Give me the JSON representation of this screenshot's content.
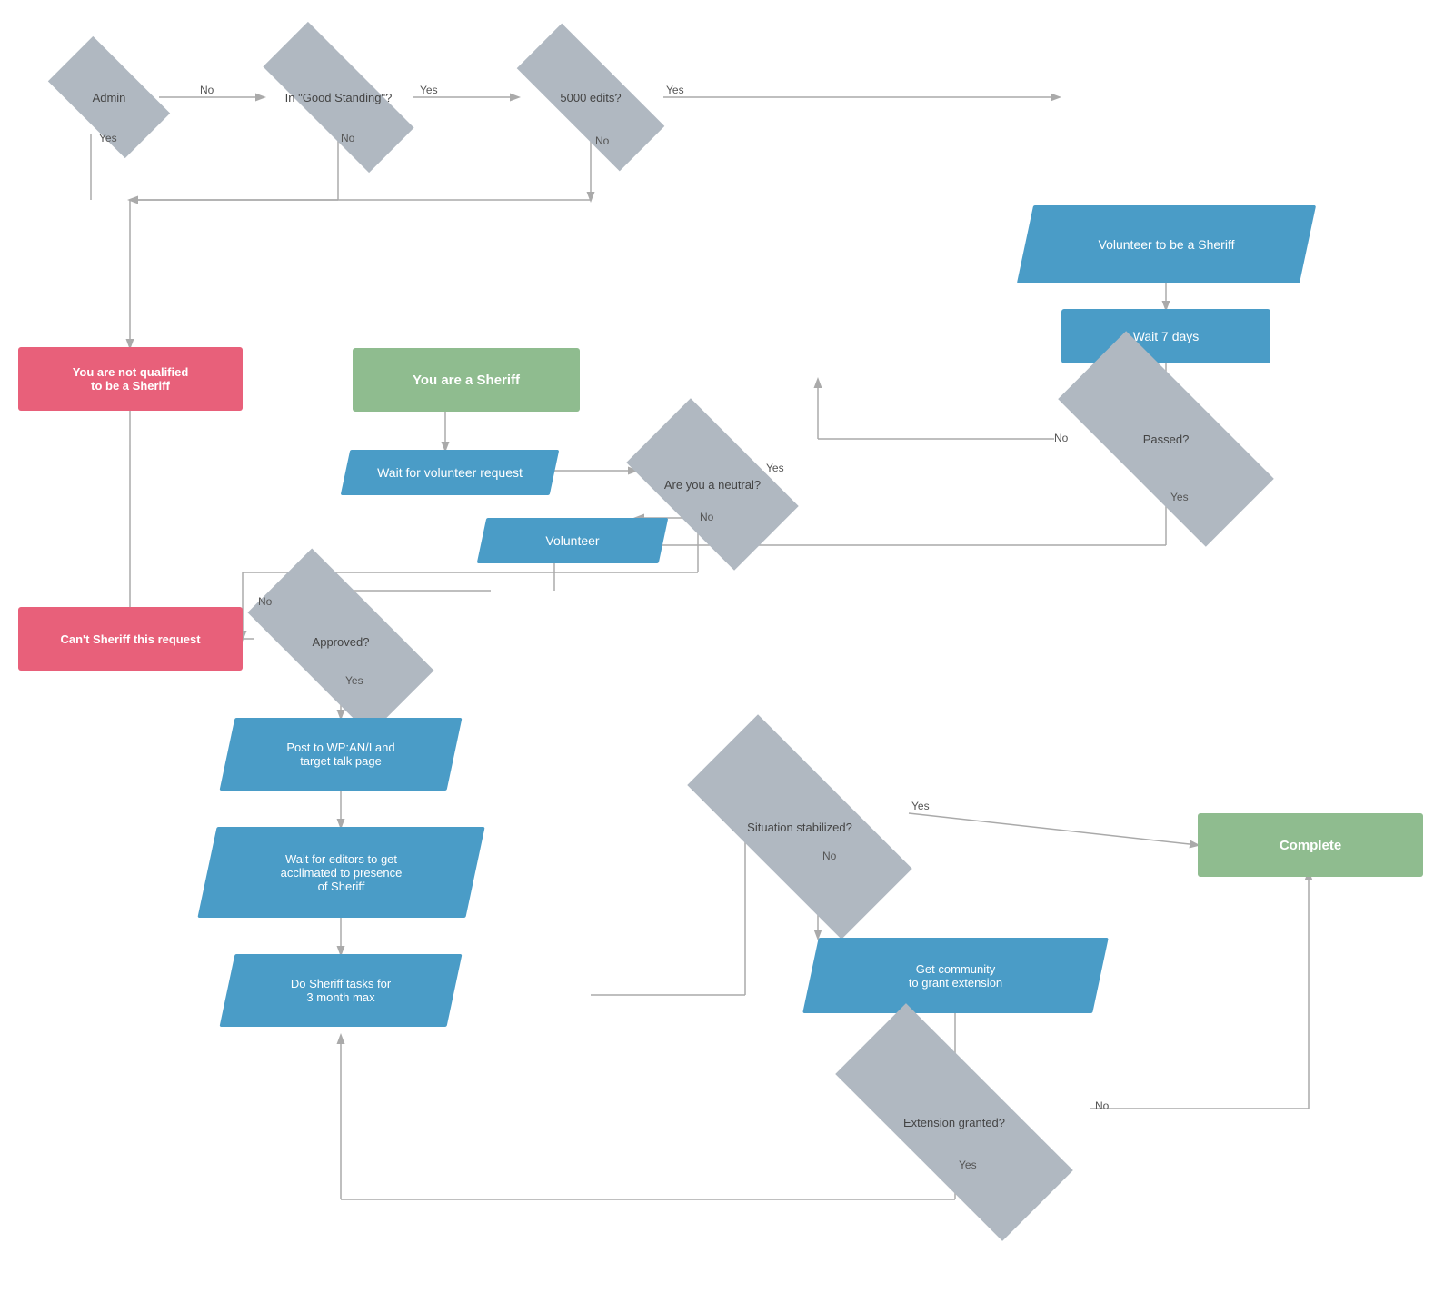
{
  "nodes": {
    "admin": {
      "label": "Admin"
    },
    "good_standing": {
      "label": "In \"Good Standing\"?"
    },
    "edits5000": {
      "label": "5000 edits?"
    },
    "volunteer_sheriff": {
      "label": "Volunteer to be a Sheriff"
    },
    "wait7days": {
      "label": "Wait 7 days"
    },
    "passed": {
      "label": "Passed?"
    },
    "not_qualified": {
      "label": "You are not qualified\nto be a Sheriff"
    },
    "you_are_sheriff": {
      "label": "You are a Sheriff"
    },
    "wait_volunteer": {
      "label": "Wait for volunteer request"
    },
    "are_you_neutral": {
      "label": "Are you\na neutral?"
    },
    "volunteer": {
      "label": "Volunteer"
    },
    "cant_sheriff": {
      "label": "Can't Sheriff this request"
    },
    "approved": {
      "label": "Approved?"
    },
    "post_wp": {
      "label": "Post to WP:AN/I and\ntarget talk page"
    },
    "wait_editors": {
      "label": "Wait for editors to get\nacclimated to presence\nof Sheriff"
    },
    "do_sheriff": {
      "label": "Do Sheriff tasks for\n3 month max"
    },
    "situation": {
      "label": "Situation stabilized?"
    },
    "complete": {
      "label": "Complete"
    },
    "get_community": {
      "label": "Get community\nto grant extension"
    },
    "extension": {
      "label": "Extension\ngranted?"
    }
  },
  "arrows": {
    "labels": {
      "admin_no": "No",
      "admin_yes": "Yes",
      "good_standing_yes": "Yes",
      "good_standing_no": "No",
      "edits_yes": "Yes",
      "edits_no": "No",
      "passed_no": "No",
      "passed_yes": "Yes",
      "neutral_yes": "Yes",
      "neutral_no": "No",
      "approved_no": "No",
      "approved_yes": "Yes",
      "situation_yes": "Yes",
      "situation_no": "No",
      "extension_no": "No",
      "extension_yes": "Yes"
    }
  }
}
